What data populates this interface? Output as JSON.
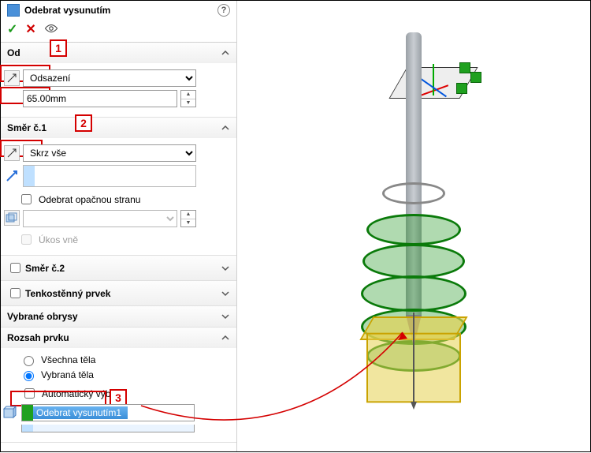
{
  "header": {
    "title": "Odebrat vysunutím"
  },
  "confirm": {
    "ok": "✓",
    "cancel": "✕"
  },
  "od": {
    "title": "Od",
    "start_condition": "Odsazení",
    "offset_value": "65.00mm",
    "callout": "1"
  },
  "dir1": {
    "title": "Směr č.1",
    "end_condition": "Skrz vše",
    "depth_value": "",
    "flip_label": "Odebrat opačnou stranu",
    "draft_label": "Úkos vně",
    "callout": "2"
  },
  "dir2": {
    "title": "Směr č.2"
  },
  "thin": {
    "title": "Tenkostěnný prvek"
  },
  "contours": {
    "title": "Vybrané obrysy"
  },
  "scope": {
    "title": "Rozsah prvku",
    "opt_all": "Všechna těla",
    "opt_sel": "Vybraná těla",
    "auto_label": "Automatický výběr",
    "selected_body": "Odebrat vysunutím1",
    "callout": "3"
  }
}
